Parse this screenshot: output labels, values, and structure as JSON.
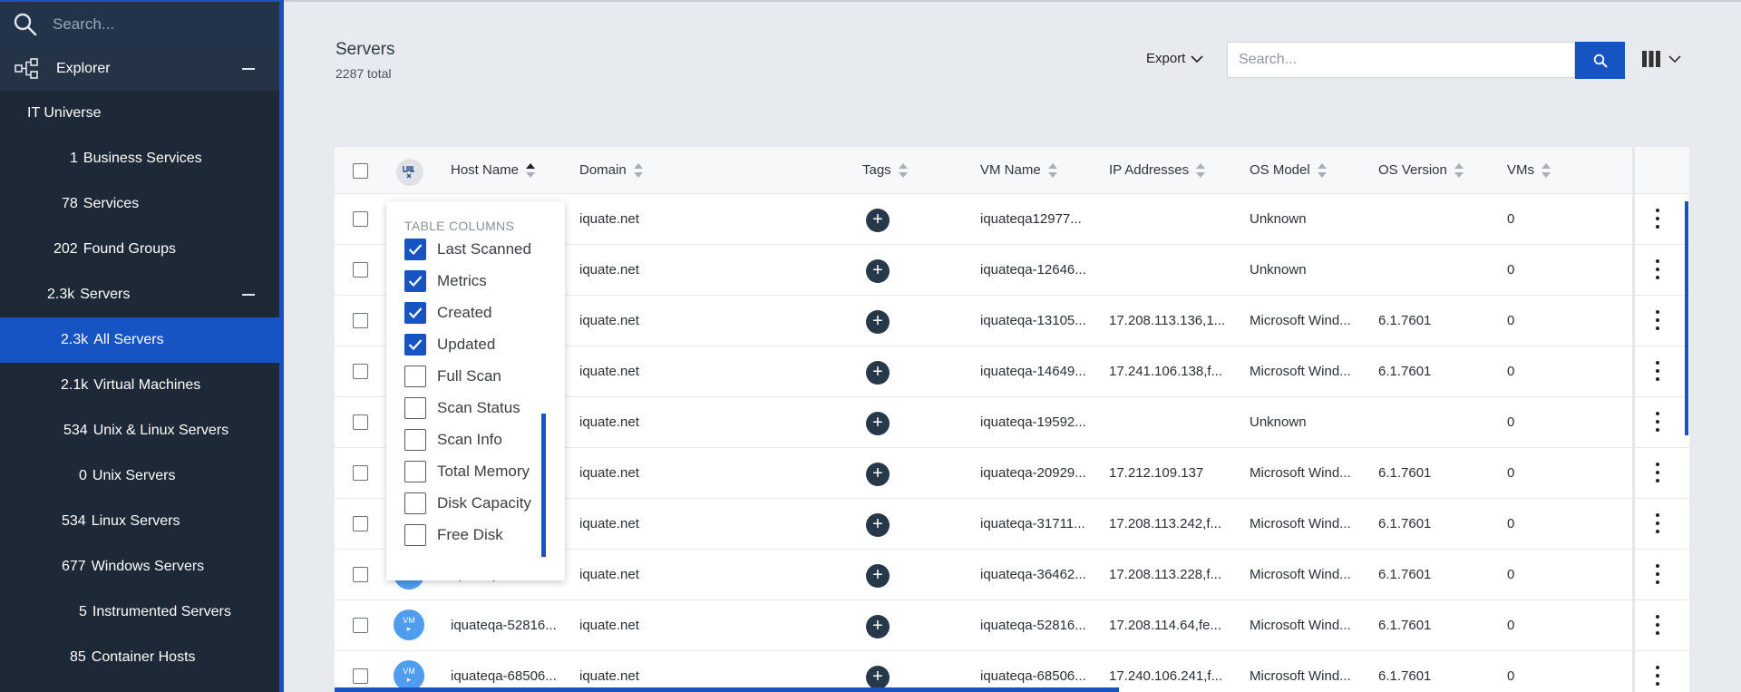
{
  "sidebar": {
    "search_placeholder": "Search...",
    "explorer_label": "Explorer",
    "items": [
      {
        "count": "",
        "label": "IT Universe"
      },
      {
        "count": "1",
        "label": "Business Services"
      },
      {
        "count": "78",
        "label": "Services"
      },
      {
        "count": "202",
        "label": "Found Groups"
      },
      {
        "count": "2.3k",
        "label": "Servers"
      },
      {
        "count": "2.3k",
        "label": "All Servers"
      },
      {
        "count": "2.1k",
        "label": "Virtual Machines"
      },
      {
        "count": "534",
        "label": "Unix & Linux Servers"
      },
      {
        "count": "0",
        "label": "Unix Servers"
      },
      {
        "count": "534",
        "label": "Linux Servers"
      },
      {
        "count": "677",
        "label": "Windows Servers"
      },
      {
        "count": "5",
        "label": "Instrumented Servers"
      },
      {
        "count": "85",
        "label": "Container Hosts"
      }
    ]
  },
  "header": {
    "title": "Servers",
    "subtitle": "2287 total",
    "export_label": "Export",
    "search_placeholder": "Search..."
  },
  "table": {
    "columns": [
      "Host Name",
      "Domain",
      "Tags",
      "VM Name",
      "IP Addresses",
      "OS Model",
      "OS Version",
      "VMs"
    ],
    "rows": [
      {
        "host": "",
        "domain": "iquate.net",
        "vm": "iquateqa12977...",
        "ip": "",
        "os": "Unknown",
        "ver": "",
        "vms": "0"
      },
      {
        "host": "",
        "domain": "iquate.net",
        "vm": "iquateqa-12646...",
        "ip": "",
        "os": "Unknown",
        "ver": "",
        "vms": "0"
      },
      {
        "host": "",
        "domain": "iquate.net",
        "vm": "iquateqa-13105...",
        "ip": "17.208.113.136,1...",
        "os": "Microsoft Wind...",
        "ver": "6.1.7601",
        "vms": "0"
      },
      {
        "host": "",
        "domain": "iquate.net",
        "vm": "iquateqa-14649...",
        "ip": "17.241.106.138,f...",
        "os": "Microsoft Wind...",
        "ver": "6.1.7601",
        "vms": "0"
      },
      {
        "host": "",
        "domain": "iquate.net",
        "vm": "iquateqa-19592...",
        "ip": "",
        "os": "Unknown",
        "ver": "",
        "vms": "0"
      },
      {
        "host": "",
        "domain": "iquate.net",
        "vm": "iquateqa-20929...",
        "ip": "17.212.109.137",
        "os": "Microsoft Wind...",
        "ver": "6.1.7601",
        "vms": "0"
      },
      {
        "host": "",
        "domain": "iquate.net",
        "vm": "iquateqa-31711...",
        "ip": "17.208.113.242,f...",
        "os": "Microsoft Wind...",
        "ver": "6.1.7601",
        "vms": "0"
      },
      {
        "host": "iquateqa-36462...",
        "domain": "iquate.net",
        "vm": "iquateqa-36462...",
        "ip": "17.208.113.228,f...",
        "os": "Microsoft Wind...",
        "ver": "6.1.7601",
        "vms": "0"
      },
      {
        "host": "iquateqa-52816...",
        "domain": "iquate.net",
        "vm": "iquateqa-52816...",
        "ip": "17.208.114.64,fe...",
        "os": "Microsoft Wind...",
        "ver": "6.1.7601",
        "vms": "0"
      },
      {
        "host": "iquateqa-68506...",
        "domain": "iquate.net",
        "vm": "iquateqa-68506...",
        "ip": "17.240.106.241,f...",
        "os": "Microsoft Wind...",
        "ver": "6.1.7601",
        "vms": "0"
      }
    ],
    "vm_badge_text": "VM"
  },
  "columns_menu": {
    "title": "TABLE COLUMNS",
    "items": [
      {
        "label": "Last Scanned",
        "checked": true
      },
      {
        "label": "Metrics",
        "checked": true
      },
      {
        "label": "Created",
        "checked": true
      },
      {
        "label": "Updated",
        "checked": true
      },
      {
        "label": "Full Scan",
        "checked": false
      },
      {
        "label": "Scan Status",
        "checked": false
      },
      {
        "label": "Scan Info",
        "checked": false
      },
      {
        "label": "Total Memory",
        "checked": false
      },
      {
        "label": "Disk Capacity",
        "checked": false
      },
      {
        "label": "Free Disk",
        "checked": false
      }
    ]
  },
  "colors": {
    "accent": "#1654c4",
    "sidebar_bg": "#1d2936",
    "tag_plus": "#26384a",
    "vm_badge": "#4f9cf0"
  },
  "icons": {
    "search": "search-icon",
    "explorer": "network-icon",
    "columns": "columns-icon",
    "row_menu": "kebab-icon"
  }
}
